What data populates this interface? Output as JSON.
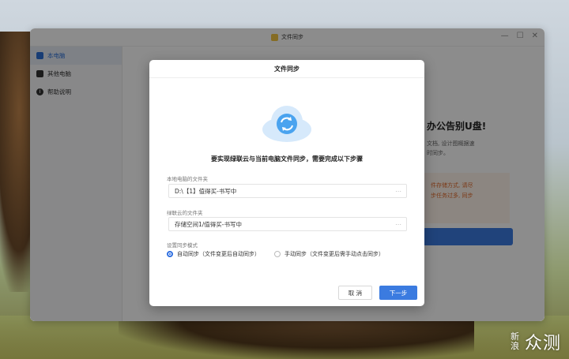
{
  "window": {
    "title": "文件同步",
    "controls": [
      "—",
      "☐",
      "✕"
    ]
  },
  "sidebar": {
    "items": [
      {
        "label": "本电脑",
        "icon": "monitor-icon",
        "active": true
      },
      {
        "label": "其他电脑",
        "icon": "computer-icon",
        "active": false
      },
      {
        "label": "帮助说明",
        "icon": "info-icon",
        "active": false
      }
    ]
  },
  "background_page": {
    "promo_title": "办公告别U盘!",
    "promo_desc_line1": "文档, 设计图概据速",
    "promo_desc_line2": "时同步。",
    "warn_line1": "件存储方式, 请尽",
    "warn_line2": "步任务过多, 同步"
  },
  "dialog": {
    "title": "文件同步",
    "prompt": "要实现绿联云与当前电脑文件同步，需要完成以下步骤",
    "local_folder_label": "本地电脑的文件夹",
    "local_folder_value": "D:\\【1】值得买-书写中",
    "cloud_folder_label": "绿联云的文件夹",
    "cloud_folder_value": "存储空间1/值得买-书写中",
    "sync_mode_label": "设置同步模式",
    "mode_auto": "自动同步（文件变更后自动同步）",
    "mode_manual": "手动同步（文件变更后需手动点击同步）",
    "selected_mode": "auto",
    "cancel_label": "取 消",
    "next_label": "下一步"
  },
  "watermark": {
    "small": "新浪",
    "large": "众测"
  },
  "colors": {
    "accent": "#3b7be0",
    "warning": "#e06a2a"
  }
}
